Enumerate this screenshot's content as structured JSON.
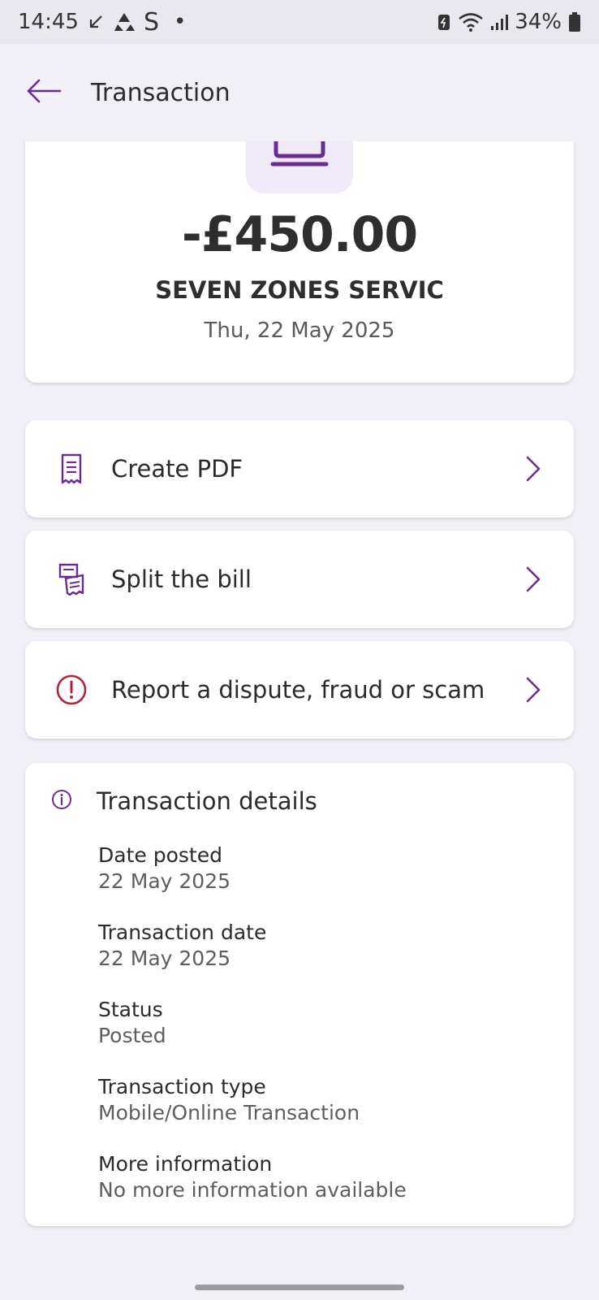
{
  "status_bar": {
    "time": "14:45",
    "carrier_letter": "S",
    "dot": "•",
    "battery": "34%"
  },
  "app_bar": {
    "title": "Transaction",
    "back_icon": "arrow-left-icon"
  },
  "summary": {
    "amount": "-£450.00",
    "merchant": "SEVEN ZONES SERVIC",
    "date": "Thu, 22 May 2025",
    "logo_icon": "laptop-icon"
  },
  "actions": [
    {
      "label": "Create PDF",
      "icon": "receipt-icon"
    },
    {
      "label": "Split the bill",
      "icon": "split-bill-icon"
    },
    {
      "label": "Report a dispute, fraud or scam",
      "icon": "alert-circle-icon"
    }
  ],
  "details": {
    "title": "Transaction details",
    "items": [
      {
        "label": "Date posted",
        "value": "22 May 2025"
      },
      {
        "label": "Transaction date",
        "value": "22 May 2025"
      },
      {
        "label": "Status",
        "value": "Posted"
      },
      {
        "label": "Transaction type",
        "value": "Mobile/Online Transaction"
      },
      {
        "label": "More information",
        "value": "No more information available"
      }
    ]
  },
  "colors": {
    "accent": "#6a2c91",
    "alert": "#b0243a",
    "background": "#f1f0f7",
    "card": "#ffffff"
  }
}
